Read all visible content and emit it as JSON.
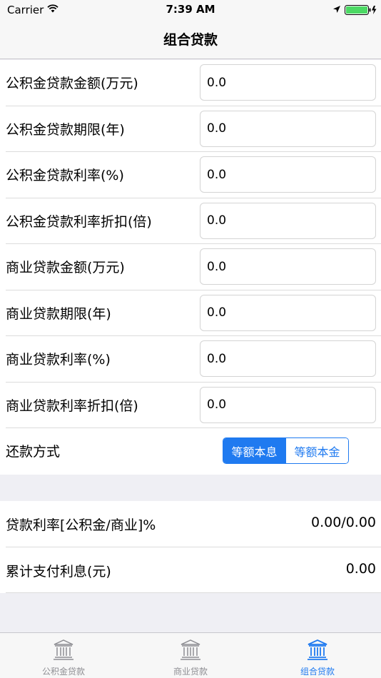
{
  "status_bar": {
    "carrier": "Carrier",
    "time": "7:39 AM"
  },
  "nav": {
    "title": "组合贷款"
  },
  "form": {
    "rows": [
      {
        "label": "公积金贷款金额(万元)",
        "value": "0.0"
      },
      {
        "label": "公积金贷款期限(年)",
        "value": "0.0"
      },
      {
        "label": "公积金贷款利率(%)",
        "value": "0.0"
      },
      {
        "label": "公积金贷款利率折扣(倍)",
        "value": "0.0"
      },
      {
        "label": "商业贷款金额(万元)",
        "value": "0.0"
      },
      {
        "label": "商业贷款期限(年)",
        "value": "0.0"
      },
      {
        "label": "商业贷款利率(%)",
        "value": "0.0"
      },
      {
        "label": "商业贷款利率折扣(倍)",
        "value": "0.0"
      }
    ],
    "repayment": {
      "label": "还款方式",
      "options": [
        "等额本息",
        "等额本金"
      ],
      "selected": "等额本息"
    }
  },
  "results": [
    {
      "label": "贷款利率[公积金/商业]%",
      "value": "0.00/0.00"
    },
    {
      "label": "累计支付利息(元)",
      "value": "0.00"
    }
  ],
  "tabs": [
    {
      "label": "公积金贷款",
      "icon": "bank-icon",
      "active": false
    },
    {
      "label": "商业贷款",
      "icon": "bank-icon",
      "active": false
    },
    {
      "label": "组合贷款",
      "icon": "bank-icon",
      "active": true
    }
  ],
  "colors": {
    "accent": "#1f7af0",
    "inactive": "#8e8e93",
    "battery": "#4cd964"
  }
}
